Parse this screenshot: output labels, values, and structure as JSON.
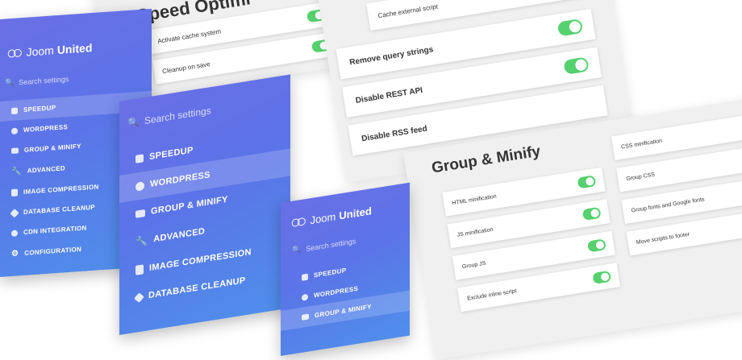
{
  "speed_panel": {
    "title": "Speed Optimi",
    "options": [
      "Activate cache system",
      "Cleanup on save"
    ]
  },
  "cache_panel": {
    "options": [
      "Cache external script",
      "Remove query strings",
      "Disable REST API",
      "Disable RSS feed"
    ]
  },
  "group_panel": {
    "title": "Group & Minify",
    "left_options": [
      "HTML minification",
      "JS minification",
      "Group JS",
      "Exclude inline script"
    ],
    "right_options": [
      "CSS minification",
      "Group CSS",
      "Group fonts and Google fonts",
      "Move scripts to footer"
    ]
  },
  "sidebar": {
    "brand_light": "Joom",
    "brand_bold": "United",
    "search_placeholder": "Search settings",
    "items": [
      {
        "label": "SPEEDUP"
      },
      {
        "label": "WORDPRESS"
      },
      {
        "label": "GROUP & MINIFY"
      },
      {
        "label": "ADVANCED"
      },
      {
        "label": "IMAGE COMPRESSION"
      },
      {
        "label": "DATABASE CLEANUP"
      },
      {
        "label": "CDN INTEGRATION"
      },
      {
        "label": "CONFIGURATION"
      }
    ]
  },
  "colors": {
    "sidebar": "#5b74e8",
    "toggle_on": "#55d16d",
    "panel_bg": "#f0f0f0"
  }
}
